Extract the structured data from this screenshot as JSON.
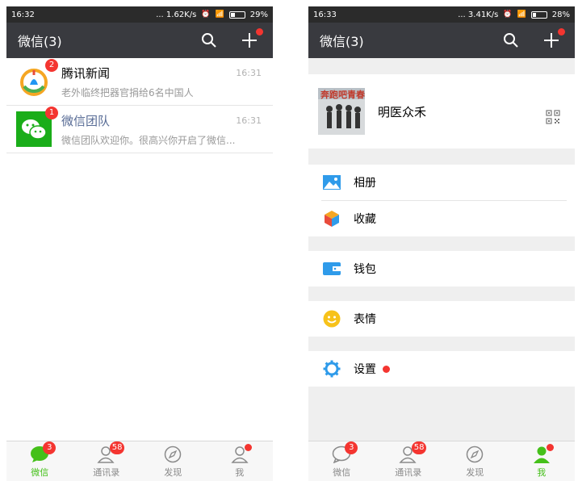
{
  "colors": {
    "accent_green": "#45c01a",
    "badge_red": "#f43530",
    "titlebar": "#393a3f",
    "statusbar": "#2b2b2b",
    "link_blue": "#576b95"
  },
  "left": {
    "statusbar": {
      "time": "16:32",
      "net": "... 1.62K/s",
      "battery": "29%",
      "battery_level": 0.29
    },
    "titlebar": {
      "title": "微信(3)",
      "search_icon": "search-icon",
      "add_icon": "plus-icon"
    },
    "chats": [
      {
        "name": "腾讯新闻",
        "message": "老外临终把器官捐给6名中国人",
        "time": "16:31",
        "badge": "2",
        "avatar": "tencent-news-icon"
      },
      {
        "name": "微信团队",
        "message": "微信团队欢迎你。很高兴你开启了微信...",
        "time": "16:31",
        "badge": "1",
        "avatar": "wechat-logo-icon"
      }
    ],
    "tabbar": [
      {
        "label": "微信",
        "badge": "3",
        "icon": "chat-bubble-icon",
        "active": true
      },
      {
        "label": "通讯录",
        "badge": "58",
        "icon": "contacts-icon"
      },
      {
        "label": "发现",
        "icon": "compass-icon"
      },
      {
        "label": "我",
        "icon": "person-icon",
        "dot": true
      }
    ]
  },
  "right": {
    "statusbar": {
      "time": "16:33",
      "net": "... 3.41K/s",
      "battery": "28%",
      "battery_level": 0.28
    },
    "titlebar": {
      "title": "微信(3)",
      "search_icon": "search-icon",
      "add_icon": "plus-icon"
    },
    "profile": {
      "name": "明医众禾",
      "qr_icon": "qr-code-icon",
      "avatar_text": "奔跑吧青春!"
    },
    "menu": {
      "album": "相册",
      "favorites": "收藏",
      "wallet": "钱包",
      "stickers": "表情",
      "settings": "设置"
    },
    "tabbar": [
      {
        "label": "微信",
        "badge": "3",
        "icon": "chat-bubble-icon"
      },
      {
        "label": "通讯录",
        "badge": "58",
        "icon": "contacts-icon"
      },
      {
        "label": "发现",
        "icon": "compass-icon"
      },
      {
        "label": "我",
        "icon": "person-icon",
        "dot": true,
        "active": true
      }
    ]
  }
}
